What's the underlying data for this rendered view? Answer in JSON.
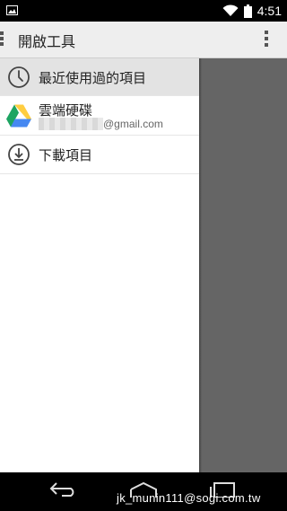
{
  "status_bar": {
    "time": "4:51",
    "icons": [
      "image-notification-icon",
      "wifi-icon",
      "battery-icon"
    ]
  },
  "action_bar": {
    "title": "開啟工具"
  },
  "drawer": {
    "items": [
      {
        "label": "最近使用過的項目",
        "icon": "clock-icon",
        "selected": true
      },
      {
        "label": "雲端硬碟",
        "icon": "google-drive-icon",
        "account_suffix": "@gmail.com",
        "selected": false
      },
      {
        "label": "下載項目",
        "icon": "download-icon",
        "selected": false
      }
    ]
  },
  "colors": {
    "action_bar_bg": "#eeeeee",
    "selected_bg": "#e3e3e3",
    "scrim": "#656565",
    "drive_green": "#1da462",
    "drive_yellow": "#ffcd40",
    "drive_blue": "#4688f1"
  },
  "watermark": "jk_munin111@sogi.com.tw"
}
